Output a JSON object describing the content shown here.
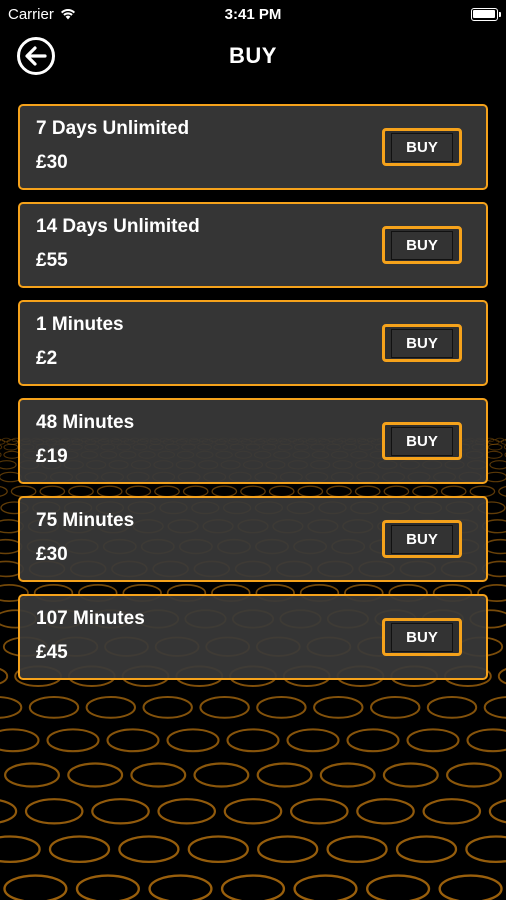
{
  "status_bar": {
    "carrier": "Carrier",
    "time": "3:41 PM",
    "icons": [
      "wifi-icon",
      "battery-icon"
    ]
  },
  "header": {
    "title": "BUY",
    "back_icon": "arrow-left-icon"
  },
  "colors": {
    "accent": "#f5a21b",
    "card_bg": "#3a3a3a",
    "background": "#000000"
  },
  "packages": [
    {
      "name": "7 Days Unlimited",
      "price": "£30",
      "button": "BUY"
    },
    {
      "name": "14 Days Unlimited",
      "price": "£55",
      "button": "BUY"
    },
    {
      "name": "1 Minutes",
      "price": "£2",
      "button": "BUY"
    },
    {
      "name": "48 Minutes",
      "price": "£19",
      "button": "BUY"
    },
    {
      "name": "75 Minutes",
      "price": "£30",
      "button": "BUY"
    },
    {
      "name": "107 Minutes",
      "price": "£45",
      "button": "BUY"
    }
  ]
}
